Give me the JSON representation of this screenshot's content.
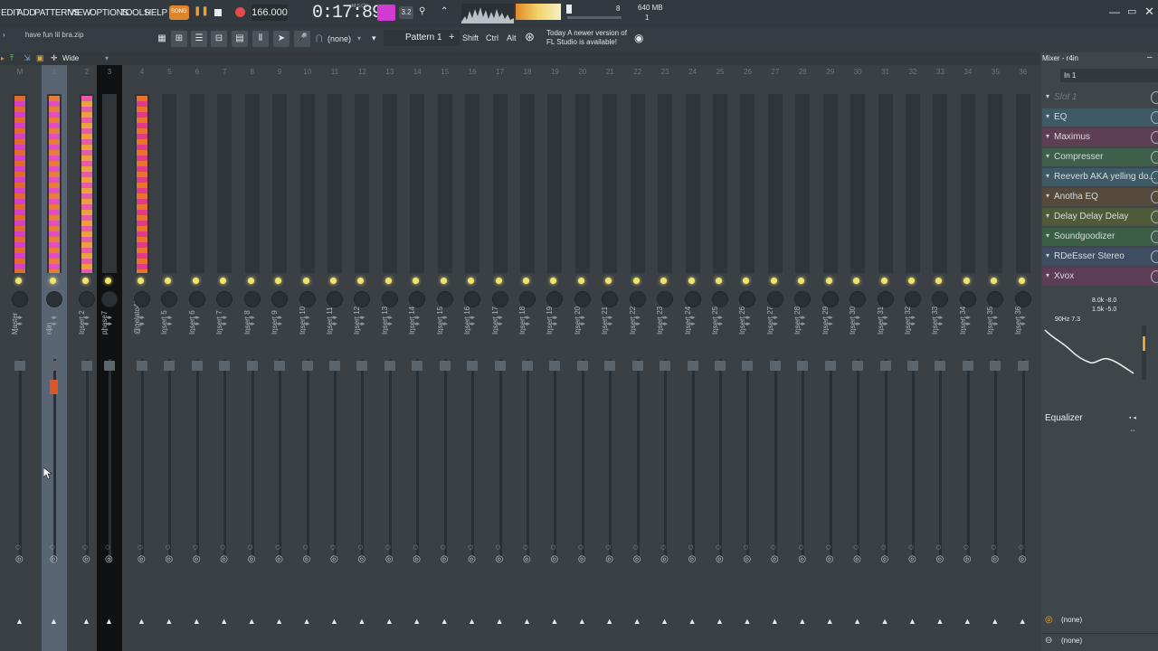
{
  "menu": [
    "EDIT",
    "ADD",
    "PATTERNS",
    "VIEW",
    "OPTIONS",
    "TOOLS",
    "HELP"
  ],
  "transport": {
    "tempo": "166.000",
    "time": "0:17:89",
    "time_unit": "M:S:CS",
    "song_label": "SONG"
  },
  "counters": {
    "voices": "8",
    "memory": "640 MB",
    "cpu": "1"
  },
  "hint": "have fun lil bra.zip",
  "snap": "(none)",
  "pattern": "Pattern 1",
  "modifiers": [
    "Shift",
    "Ctrl",
    "Alt"
  ],
  "news": {
    "line1": "Today  A newer version of",
    "line2": "FL Studio is available!"
  },
  "mixer": {
    "view_label": "Wide",
    "strips": [
      {
        "num": "M",
        "name": "Master"
      },
      {
        "num": "1",
        "name": "r4in"
      },
      {
        "num": "2",
        "name": "Insert 2"
      },
      {
        "num": "3",
        "name": "phase7"
      },
      {
        "num": "4",
        "name": "@gelato43"
      },
      {
        "num": "5",
        "name": "Insert 5"
      },
      {
        "num": "6",
        "name": "Insert 6"
      },
      {
        "num": "7",
        "name": "Insert 7"
      },
      {
        "num": "8",
        "name": "Insert 8"
      },
      {
        "num": "9",
        "name": "Insert 9"
      },
      {
        "num": "10",
        "name": "Insert 10"
      },
      {
        "num": "11",
        "name": "Insert 11"
      },
      {
        "num": "12",
        "name": "Insert 12"
      },
      {
        "num": "13",
        "name": "Insert 13"
      },
      {
        "num": "14",
        "name": "Insert 14"
      },
      {
        "num": "15",
        "name": "Insert 15"
      },
      {
        "num": "16",
        "name": "Insert 16"
      },
      {
        "num": "17",
        "name": "Insert 17"
      },
      {
        "num": "18",
        "name": "Insert 18"
      },
      {
        "num": "19",
        "name": "Insert 19"
      },
      {
        "num": "20",
        "name": "Insert 20"
      },
      {
        "num": "21",
        "name": "Insert 21"
      },
      {
        "num": "22",
        "name": "Insert 22"
      },
      {
        "num": "23",
        "name": "Insert 23"
      },
      {
        "num": "24",
        "name": "Insert 24"
      },
      {
        "num": "25",
        "name": "Insert 25"
      },
      {
        "num": "26",
        "name": "Insert 26"
      },
      {
        "num": "27",
        "name": "Insert 27"
      },
      {
        "num": "28",
        "name": "Insert 28"
      },
      {
        "num": "29",
        "name": "Insert 29"
      },
      {
        "num": "30",
        "name": "Insert 30"
      },
      {
        "num": "31",
        "name": "Insert 31"
      },
      {
        "num": "32",
        "name": "Insert 32"
      },
      {
        "num": "33",
        "name": "Insert 33"
      },
      {
        "num": "34",
        "name": "Insert 34"
      },
      {
        "num": "35",
        "name": "Insert 35"
      },
      {
        "num": "36",
        "name": "Insert 36"
      }
    ]
  },
  "panel": {
    "title": "Mixer - r4in",
    "input": "In 1",
    "slots": [
      {
        "label": "Slot 1",
        "color": "#3f464a",
        "dim": true
      },
      {
        "label": "EQ",
        "color": "#3d5a66"
      },
      {
        "label": "Maximus",
        "color": "#5e3f52"
      },
      {
        "label": "Compresser",
        "color": "#3e5f4a"
      },
      {
        "label": "Reeverb AKA yelling do...",
        "color": "#3d5a66"
      },
      {
        "label": "Anotha EQ",
        "color": "#54493a"
      },
      {
        "label": "Delay Delay Delay",
        "color": "#4f5a3a"
      },
      {
        "label": "Soundgoodizer",
        "color": "#3c5d46"
      },
      {
        "label": "RDeEsser Stereo",
        "color": "#3f4d63"
      },
      {
        "label": "Xvox",
        "color": "#5c3d55"
      }
    ],
    "eq_readout1": "8.0k -8.0",
    "eq_readout2": "1.5k -5.0",
    "eq_readout3": "90Hz 7.3",
    "eq_name": "Equalizer",
    "out1": "(none)",
    "out2": "(none)"
  }
}
